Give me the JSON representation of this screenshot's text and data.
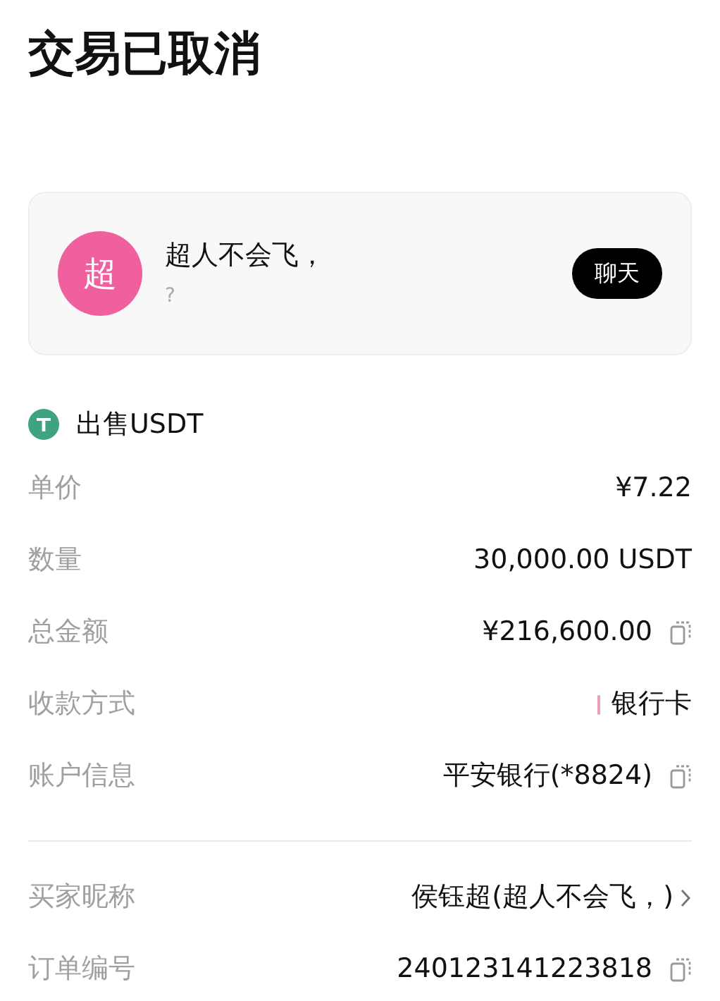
{
  "title": "交易已取消",
  "counterparty": {
    "avatar": "超",
    "name": "超人不会飞，",
    "status": "?",
    "chat_button": "聊天"
  },
  "order_type": "出售USDT",
  "details": [
    {
      "kind": "plain",
      "label": "单价",
      "value": "¥7.22"
    },
    {
      "kind": "plain",
      "label": "数量",
      "value": "30,000.00 USDT"
    },
    {
      "kind": "copy",
      "label": "总金额",
      "value": "¥216,600.00"
    },
    {
      "kind": "method",
      "label": "收款方式",
      "value": "银行卡",
      "color": "#e8a0b4"
    },
    {
      "kind": "copy",
      "label": "账户信息",
      "value": "平安银行(*8824)"
    }
  ],
  "more_details": [
    {
      "kind": "link",
      "label": "买家昵称",
      "value": "侯钰超(超人不会飞，)"
    },
    {
      "kind": "copy",
      "label": "订单编号",
      "value": "240123141223818"
    }
  ]
}
